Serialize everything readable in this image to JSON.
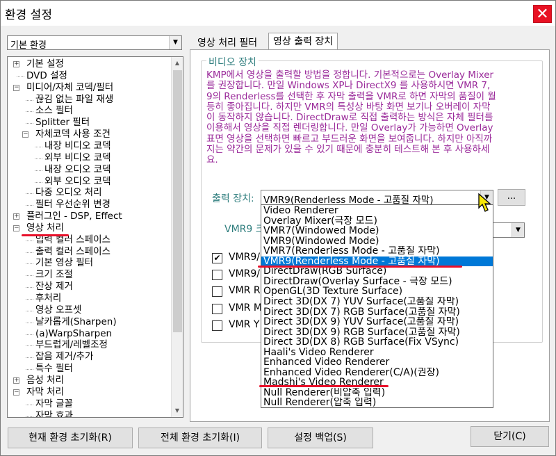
{
  "window": {
    "title": "환경 설정",
    "close_label": "✕"
  },
  "left": {
    "category_select": {
      "value": "기본 환경"
    },
    "tree_items": [
      "기본 설정",
      "DVD 설정",
      "미디어/자체 코덱/필터",
      "끊김 없는 파일 재생",
      "소스 필터",
      "Splitter 필터",
      "자체코덱 사용 조건",
      "내장 비디오 코덱",
      "외부 비디오 코덱",
      "내장 오디오 코덱",
      "외부 오디오 코덱",
      "다중 오디오 처리",
      "필터 우선순위 변경",
      "플러그인 - DSP, Effect",
      "영상 처리",
      "입력 컬러 스페이스",
      "출력 컬러 스페이스",
      "기본 영상 필터",
      "크기 조절",
      "잔상 제거",
      "후처리",
      "영상 오프셋",
      "날카롭게(Sharpen)",
      "(a)WarpSharpen",
      "부드럽게/레벨조정",
      "잡음 제거/추가",
      "특수 필터",
      "음성 처리",
      "자막 처리",
      "자막 글꼴",
      "자막 효과"
    ]
  },
  "tabs": [
    {
      "label": "영상 처리 필터"
    },
    {
      "label": "영상 출력 장치"
    }
  ],
  "video_device": {
    "group_title": "비디오 장치",
    "description": "KMP에서 영상을 출력할 방법을 정합니다. 기본적으로는 Overlay Mixer를 권장합니다. 만일 Windows XP나 DirectX9 를 사용하시면 VMR 7, 9의 Renderless를 선택한 후 자막 출력을 VMR로 하면 자막의 품질이 월등히 좋아집니다. 하지만 VMR의 특성상 바탕 화면 보기나 오버레이 자막이 동작하지 않습니다. DirectDraw로 직접 출력하는 방식은 자체 필터를 이용해서 영상을 직접 렌더링합니다. 만일 Overlay가 가능하면 Overlay 표면 영상을 선택하면 빠르고 부드러운 화면을 보여줍니다. 하지만 아직까지는 약간의 문제가 있을 수 있기 때문에 충분히 테스트해 본 후 사용하세요.",
    "output_label": "출력 장치:",
    "output_value": "VMR9(Renderless Mode - 고품질 자막)",
    "dots_label": "...",
    "vmr9_label": "VMR9 크",
    "checkboxes": [
      {
        "label": "VMR9/",
        "checked": true
      },
      {
        "label": "VMR9/",
        "checked": false
      },
      {
        "label": "VMR R",
        "checked": false
      },
      {
        "label": "VMR M",
        "checked": false
      },
      {
        "label": "VMR Y",
        "checked": false
      }
    ],
    "dropdown_options": [
      "Video Renderer",
      "Overlay Mixer(극장 모드)",
      "VMR7(Windowed Mode)",
      "VMR9(Windowed Mode)",
      "VMR7(Renderless Mode - 고품질 자막)",
      "VMR9(Renderless Mode - 고품질 자막)",
      "DirectDraw(RGB Surface)",
      "DirectDraw(Overlay Surface - 극장 모드)",
      "OpenGL(3D Texture Surface)",
      "Direct 3D(DX 7) YUV Surface(고품질 자막)",
      "Direct 3D(DX 7) RGB Surface(고품질 자막)",
      "Direct 3D(DX 9) YUV Surface(고품질 자막)",
      "Direct 3D(DX 9) RGB Surface(고품질 자막)",
      "Direct 3D(DX 8) RGB Surface(Fix VSync)",
      "Haali's Video Renderer",
      "Enhanced Video Renderer",
      "Enhanced Video Renderer(C/A)(권장)",
      "Madshi's Video Renderer",
      "Null Renderer(비압축 입력)",
      "Null Renderer(압축 입력)"
    ],
    "selected_index": 5
  },
  "buttons": {
    "reset_current": "현재 환경 초기화(R)",
    "reset_all": "전체 환경 초기화(I)",
    "backup": "설정 백업(S)",
    "close": "닫기(C)"
  },
  "colors": {
    "highlight": "#0078d7",
    "annotation_red": "#e8102a",
    "teal_label": "#2f7e7e",
    "purple_text": "#9a2a9a"
  }
}
